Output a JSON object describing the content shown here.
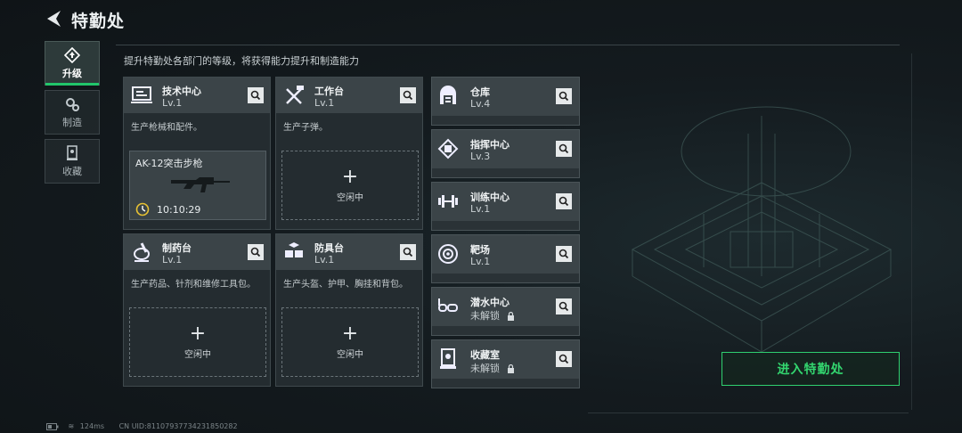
{
  "header": {
    "title": "特勤处",
    "subtitle": "提升特勤处各部门的等级，将获得能力提升和制造能力"
  },
  "tabs": [
    {
      "label": "升级",
      "icon": "upgrade-icon",
      "active": true
    },
    {
      "label": "制造",
      "icon": "gears-icon",
      "active": false
    },
    {
      "label": "收藏",
      "icon": "collection-icon",
      "active": false
    }
  ],
  "cards": {
    "tech": {
      "name": "技术中心",
      "level": "Lv.1",
      "desc": "生产枪械和配件。",
      "product": "AK-12突击步枪",
      "timer": "10:10:29"
    },
    "workbench": {
      "name": "工作台",
      "level": "Lv.1",
      "desc": "生产子弹。",
      "slot": "空闲中"
    },
    "pharmacy": {
      "name": "制药台",
      "level": "Lv.1",
      "desc": "生产药品、针剂和维修工具包。",
      "slot": "空闲中"
    },
    "armor": {
      "name": "防具台",
      "level": "Lv.1",
      "desc": "生产头盔、护甲、胸挂和背包。",
      "slot": "空闲中"
    }
  },
  "facilities": [
    {
      "name": "仓库",
      "level": "Lv.4",
      "icon": "warehouse-icon"
    },
    {
      "name": "指挥中心",
      "level": "Lv.3",
      "icon": "chip-icon"
    },
    {
      "name": "训练中心",
      "level": "Lv.1",
      "icon": "dumbbell-icon"
    },
    {
      "name": "靶场",
      "level": "Lv.1",
      "icon": "target-icon"
    },
    {
      "name": "潜水中心",
      "level": "未解锁",
      "icon": "diving-mask-icon",
      "locked": true
    },
    {
      "name": "收藏室",
      "level": "未解锁",
      "icon": "display-case-icon",
      "locked": true
    }
  ],
  "enter_button": "进入特勤处",
  "footer": {
    "ping": "124ms",
    "uid": "CN UID:81107937734231850282"
  },
  "colors": {
    "accent": "#21c56a",
    "panel": "#3b4448",
    "background": "#141b1f"
  }
}
